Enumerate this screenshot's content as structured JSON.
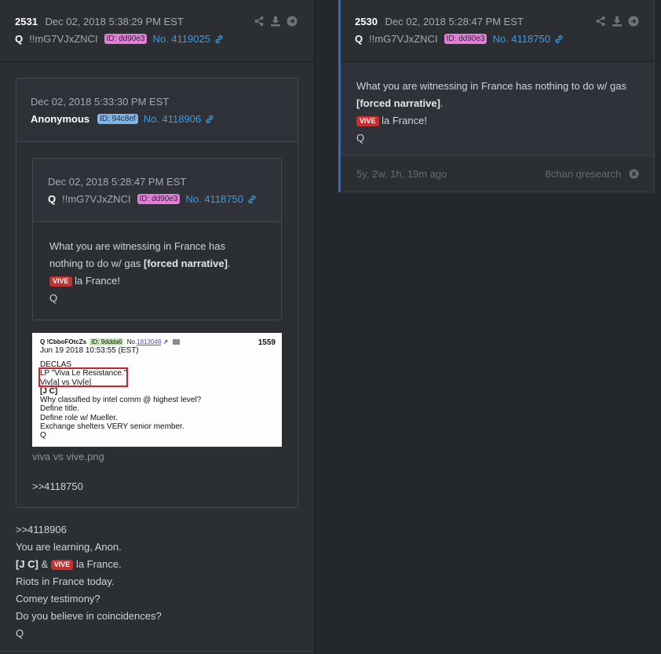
{
  "left_post": {
    "number": "2531",
    "date": "Dec 02, 2018 5:38:29 PM EST",
    "author": "Q",
    "tripcode": "!!mG7VJxZNCI",
    "id_badge": "ID: dd90e3",
    "post_no": "No. 4119025",
    "quoted": {
      "date": "Dec 02, 2018 5:33:30 PM EST",
      "author": "Anonymous",
      "id_badge": "ID: 94c8ef",
      "post_no": "No. 4118906",
      "nested": {
        "date": "Dec 02, 2018 5:28:47 PM EST",
        "author": "Q",
        "tripcode": "!!mG7VJxZNCI",
        "id_badge": "ID: dd90e3",
        "post_no": "No. 4118750",
        "line1": "What you are witnessing in France has",
        "line2a": "nothing to do w/ gas ",
        "line2b": "[forced narrative]",
        "line2c": ".",
        "vive": "VIVE",
        "line3": " la France!",
        "line4": "Q"
      },
      "image": {
        "top_author": "Q !CbboFOtcZs",
        "top_id": "ID: 9ddda6",
        "top_no": "No.",
        "top_link": "1813048",
        "top_num": "1559",
        "top_date": "Jun 19 2018 10:53:55 (EST)",
        "l1": "DECLAS",
        "l2": "LP \"Viva Le Resistance.\"",
        "l3": "Viv[a] vs Viv[e]",
        "l4": "[J C]",
        "l5": "Why classified by intel comm @ highest level?",
        "l6": "Define title.",
        "l7": "Define role w/ Mueller.",
        "l8": "Exchange shelters VERY senior member.",
        "l9": "Q"
      },
      "image_filename": "viva vs vive.png",
      "reply_ref": ">>4118750"
    },
    "body": {
      "l1": ">>4118906",
      "l2": "You are learning, Anon.",
      "l3a": "[J C]",
      "l3b": " & ",
      "l3c": "VIVE",
      "l3d": " la France.",
      "l4": "Riots in France today.",
      "l5": "Comey testimony?",
      "l6": "Do you believe in coincidences?",
      "l7": "Q"
    }
  },
  "right_post": {
    "number": "2530",
    "date": "Dec 02, 2018 5:28:47 PM EST",
    "author": "Q",
    "tripcode": "!!mG7VJxZNCI",
    "id_badge": "ID: dd90e3",
    "post_no": "No. 4118750",
    "line1": "What you are witnessing in France has nothing to do w/ gas",
    "line2": "[forced narrative]",
    "line2_tail": ".",
    "vive": "VIVE",
    "line3": " la France!",
    "line4": "Q",
    "age": "5y, 2w, 1h, 19m ago",
    "source": "8chan qresearch"
  },
  "colors": {
    "accent_link": "#3a9ee4",
    "badge_pink": "#e37fd9",
    "badge_blue": "#7fb4e6",
    "vive_red": "#c4312f",
    "post_border_blue": "#2f6ad3"
  },
  "icons": [
    "share-icon",
    "download-icon",
    "arrow-circle-right-icon",
    "link-icon",
    "close-circle-icon"
  ]
}
